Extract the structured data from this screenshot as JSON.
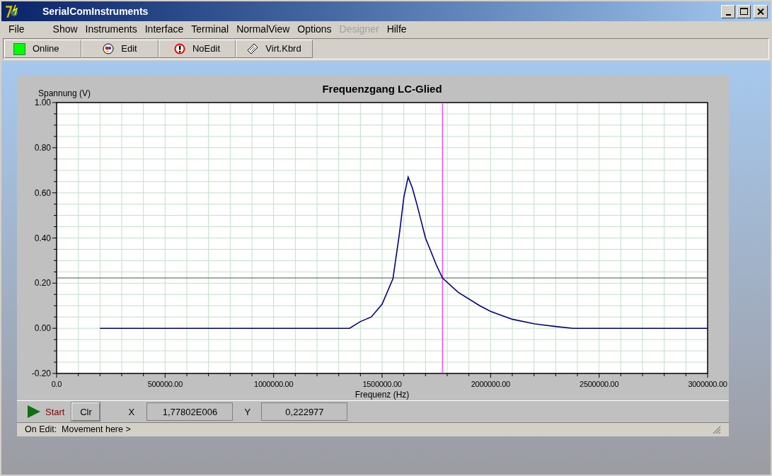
{
  "window": {
    "title": "SerialComInstruments"
  },
  "menu": [
    {
      "label": "File",
      "disabled": false
    },
    {
      "label": "Show",
      "disabled": false
    },
    {
      "label": "Instruments",
      "disabled": false
    },
    {
      "label": "Interface",
      "disabled": false
    },
    {
      "label": "Terminal",
      "disabled": false
    },
    {
      "label": "NormalView",
      "disabled": false
    },
    {
      "label": "Options",
      "disabled": false
    },
    {
      "label": "Designer",
      "disabled": true
    },
    {
      "label": "Hilfe",
      "disabled": false
    }
  ],
  "toolbar": [
    {
      "kind": "status",
      "label": "Online",
      "on": true
    },
    {
      "kind": "edit",
      "label": "Edit"
    },
    {
      "kind": "noedit",
      "label": "NoEdit"
    },
    {
      "kind": "keyboard",
      "label": "Virt.Kbrd"
    }
  ],
  "chart": {
    "chart_data": {
      "type": "line",
      "title": "Frequenzgang LC-Glied",
      "xlabel": "Frequenz (Hz)",
      "ylabel": "Spannung (V)",
      "x": [
        200000,
        1300000,
        1350000,
        1400000,
        1450000,
        1500000,
        1550000,
        1580000,
        1600000,
        1620000,
        1640000,
        1660000,
        1700000,
        1750000,
        1778020,
        1850000,
        1950000,
        2000000,
        2100000,
        2200000,
        2300000,
        2380000,
        3000000
      ],
      "series": [
        {
          "color": "#000080",
          "values": [
            0,
            0,
            0,
            0.03,
            0.05,
            0.107,
            0.22,
            0.42,
            0.58,
            0.67,
            0.62,
            0.55,
            0.4,
            0.28,
            0.223,
            0.16,
            0.1,
            0.075,
            0.04,
            0.02,
            0.008,
            0,
            0
          ]
        }
      ],
      "xlim": [
        0,
        3000000
      ],
      "ylim": [
        -0.2,
        1
      ],
      "xticks": [
        {
          "value": 0,
          "label": "0.0"
        },
        {
          "value": 500000,
          "label": "500000.00"
        },
        {
          "value": 1000000,
          "label": "1000000.00"
        },
        {
          "value": 1500000,
          "label": "1500000.00"
        },
        {
          "value": 2000000,
          "label": "2000000.00"
        },
        {
          "value": 2500000,
          "label": "2500000.00"
        },
        {
          "value": 3000000,
          "label": "3000000.00"
        }
      ],
      "yticks": [
        {
          "value": -0.2,
          "label": "-0.20"
        },
        {
          "value": 0,
          "label": "0.00"
        },
        {
          "value": 0.2,
          "label": "0.20"
        },
        {
          "value": 0.4,
          "label": "0.40"
        },
        {
          "value": 0.6,
          "label": "0.60"
        },
        {
          "value": 0.8,
          "label": "0.80"
        },
        {
          "value": 1,
          "label": "1.00"
        }
      ],
      "grid": true,
      "ref_lines": [
        {
          "axis": "x",
          "value": 1778020,
          "color": "#ff00ff"
        },
        {
          "axis": "y",
          "value": 0.222977,
          "color": "#406040"
        }
      ]
    }
  },
  "controls": {
    "start": {
      "label": "Start"
    },
    "clear": {
      "label": "Clr"
    },
    "x_label": "X",
    "x_value": "1,77802E006",
    "y_label": "Y",
    "y_value": "0,222977"
  },
  "status_bar": "On Edit:  Movement here >"
}
